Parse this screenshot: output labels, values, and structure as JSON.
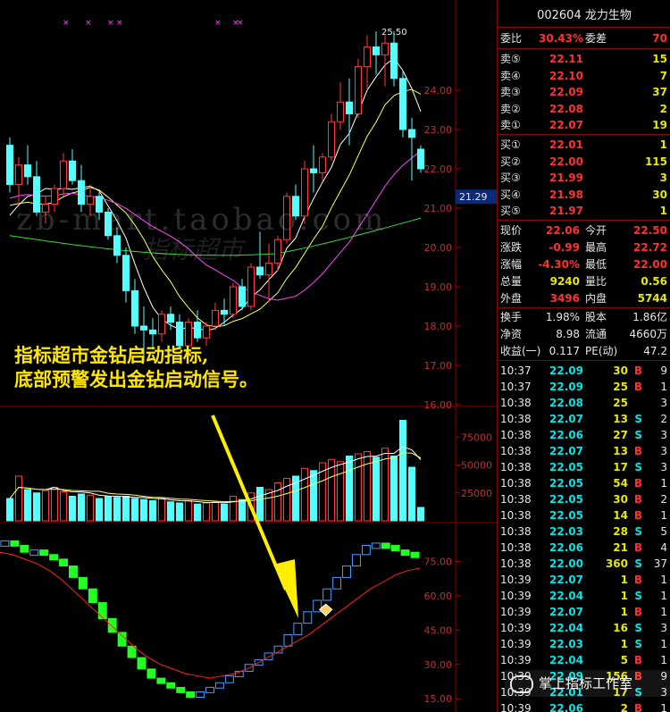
{
  "stock": {
    "code": "002604",
    "name": "龙力生物"
  },
  "price_axis": {
    "ticks": [
      {
        "label": "24.00",
        "value": 24.0
      },
      {
        "label": "23.00",
        "value": 23.0
      },
      {
        "label": "22.00",
        "value": 22.0
      },
      {
        "label": "21.00",
        "value": 21.0
      },
      {
        "label": "20.00",
        "value": 20.0
      },
      {
        "label": "19.00",
        "value": 19.0
      },
      {
        "label": "18.00",
        "value": 18.0
      },
      {
        "label": "17.00",
        "value": 17.0
      },
      {
        "label": "16.00",
        "value": 16.0
      }
    ],
    "current_label": "21.29",
    "high_label": "25.50"
  },
  "volume_axis": {
    "ticks": [
      {
        "label": "75000",
        "value": 75000
      },
      {
        "label": "50000",
        "value": 50000
      },
      {
        "label": "25000",
        "value": 25000
      }
    ]
  },
  "indicator_axis": {
    "ticks": [
      {
        "label": "75.00",
        "value": 75
      },
      {
        "label": "60.00",
        "value": 60
      },
      {
        "label": "45.00",
        "value": 45
      },
      {
        "label": "30.00",
        "value": 30
      },
      {
        "label": "15.00",
        "value": 15
      }
    ]
  },
  "chart_data": {
    "type": "candlestick",
    "title": "",
    "colors": {
      "up": "#ff3b3b",
      "down": "#54ffff",
      "ma5": "#ffffff",
      "ma10": "#ffff66",
      "ma20": "#ff44ff",
      "ma60": "#33dd33",
      "vol_up": "#ff3b3b",
      "vol_down": "#54ffff",
      "ind_up": "#4a9dff",
      "ind_down": "#22ff22",
      "signal": "#ff2020"
    },
    "ohlc": [
      [
        22.6,
        22.8,
        21.4,
        21.6
      ],
      [
        21.6,
        22.3,
        21.1,
        22.1
      ],
      [
        22.1,
        22.6,
        21.6,
        21.8
      ],
      [
        21.8,
        22.2,
        20.8,
        20.9
      ],
      [
        20.9,
        21.3,
        20.6,
        21.1
      ],
      [
        21.1,
        21.6,
        20.9,
        21.5
      ],
      [
        21.5,
        22.4,
        21.3,
        22.2
      ],
      [
        22.2,
        22.5,
        21.6,
        21.7
      ],
      [
        21.7,
        22.1,
        20.9,
        21.1
      ],
      [
        21.1,
        21.6,
        20.8,
        21.3
      ],
      [
        21.3,
        21.4,
        20.7,
        20.9
      ],
      [
        20.9,
        21.0,
        20.2,
        20.3
      ],
      [
        20.3,
        20.5,
        19.6,
        19.8
      ],
      [
        19.8,
        20.0,
        18.6,
        18.9
      ],
      [
        18.9,
        19.2,
        17.8,
        18.0
      ],
      [
        18.0,
        18.5,
        17.1,
        17.9
      ],
      [
        17.9,
        18.2,
        17.4,
        17.8
      ],
      [
        17.8,
        18.4,
        17.6,
        18.3
      ],
      [
        18.3,
        18.5,
        17.9,
        18.1
      ],
      [
        18.1,
        18.3,
        17.4,
        17.5
      ],
      [
        17.5,
        18.2,
        17.3,
        18.1
      ],
      [
        18.1,
        18.4,
        17.6,
        17.7
      ],
      [
        17.7,
        18.1,
        17.5,
        18.0
      ],
      [
        18.0,
        18.6,
        17.9,
        18.4
      ],
      [
        18.4,
        18.7,
        18.0,
        18.3
      ],
      [
        18.3,
        19.1,
        18.2,
        19.0
      ],
      [
        19.0,
        19.2,
        18.4,
        18.5
      ],
      [
        18.5,
        19.6,
        18.4,
        19.5
      ],
      [
        19.5,
        20.4,
        19.2,
        19.3
      ],
      [
        19.3,
        20.1,
        18.6,
        19.6
      ],
      [
        19.6,
        20.3,
        19.4,
        20.2
      ],
      [
        20.2,
        21.4,
        20.1,
        21.3
      ],
      [
        21.3,
        21.6,
        20.7,
        20.8
      ],
      [
        20.8,
        22.2,
        20.6,
        22.0
      ],
      [
        22.0,
        22.6,
        21.4,
        21.9
      ],
      [
        21.9,
        22.4,
        21.7,
        22.3
      ],
      [
        22.3,
        23.4,
        22.2,
        23.2
      ],
      [
        23.2,
        24.2,
        23.0,
        23.7
      ],
      [
        23.7,
        24.3,
        22.6,
        23.4
      ],
      [
        23.4,
        24.8,
        23.3,
        24.6
      ],
      [
        24.6,
        25.4,
        24.0,
        25.1
      ],
      [
        25.1,
        25.5,
        24.4,
        24.9
      ],
      [
        24.9,
        25.4,
        24.1,
        25.2
      ],
      [
        25.2,
        25.5,
        24.1,
        24.3
      ],
      [
        24.3,
        24.5,
        22.8,
        23.0
      ],
      [
        23.0,
        23.3,
        21.7,
        22.8
      ],
      [
        22.5,
        22.6,
        21.9,
        22.0
      ]
    ],
    "volume": [
      20000,
      40000,
      28000,
      25000,
      27000,
      30000,
      26000,
      22000,
      24000,
      23000,
      20000,
      22000,
      21000,
      22000,
      20000,
      19000,
      18000,
      20000,
      17000,
      16000,
      18000,
      15000,
      16000,
      17000,
      15000,
      22000,
      19000,
      25000,
      30000,
      28000,
      34000,
      38000,
      40000,
      47000,
      45000,
      52000,
      55000,
      53000,
      58000,
      60000,
      62000,
      57000,
      65000,
      58000,
      90000,
      48000,
      12000
    ],
    "indicator": [
      84,
      82,
      79,
      80,
      78,
      76,
      73,
      68,
      63,
      57,
      50,
      44,
      38,
      33,
      28,
      24,
      22,
      20,
      18,
      17,
      18,
      20,
      22,
      25,
      27,
      30,
      32,
      35,
      38,
      43,
      48,
      53,
      58,
      63,
      68,
      73,
      78,
      82,
      83,
      82,
      80,
      79,
      77
    ],
    "indicator_signal": [
      79,
      78,
      76,
      74,
      71,
      67,
      62,
      57,
      52,
      47,
      42,
      37,
      33,
      30,
      28,
      26,
      25,
      24,
      25,
      26,
      28,
      31,
      34,
      37,
      40,
      43,
      47,
      51,
      55,
      59,
      63,
      66,
      69,
      71,
      72
    ],
    "signal_index": 33,
    "ylim_price": [
      16.0,
      26.0
    ],
    "ylim_volume": [
      0,
      100000
    ],
    "ylim_indicator": [
      10,
      90
    ]
  },
  "annotation": {
    "line1": "指标超市金钻启动指标,",
    "line2": "底部预警发出金钻启动信号。"
  },
  "watermark": {
    "text": "zb-mart.taobao.com",
    "sub": "指标超市"
  },
  "quote": {
    "weibi_label": "委比",
    "weibi": "30.43%",
    "weicha_label": "委差",
    "weicha": "70",
    "asks": [
      {
        "label": "卖⑤",
        "price": "22.11",
        "vol": "15"
      },
      {
        "label": "卖④",
        "price": "22.10",
        "vol": "7"
      },
      {
        "label": "卖③",
        "price": "22.09",
        "vol": "37"
      },
      {
        "label": "卖②",
        "price": "22.08",
        "vol": "2"
      },
      {
        "label": "卖①",
        "price": "22.07",
        "vol": "19"
      }
    ],
    "bids": [
      {
        "label": "买①",
        "price": "22.01",
        "vol": "1"
      },
      {
        "label": "买②",
        "price": "22.00",
        "vol": "115"
      },
      {
        "label": "买③",
        "price": "21.99",
        "vol": "3"
      },
      {
        "label": "买④",
        "price": "21.98",
        "vol": "30"
      },
      {
        "label": "买⑤",
        "price": "21.97",
        "vol": "1"
      }
    ],
    "stats": [
      {
        "l1": "现价",
        "v1": "22.06",
        "c1": "red",
        "l2": "今开",
        "v2": "22.50",
        "c2": "red"
      },
      {
        "l1": "涨跌",
        "v1": "-0.99",
        "c1": "red",
        "l2": "最高",
        "v2": "22.72",
        "c2": "red"
      },
      {
        "l1": "涨幅",
        "v1": "-4.30%",
        "c1": "red",
        "l2": "最低",
        "v2": "22.00",
        "c2": "red"
      },
      {
        "l1": "总量",
        "v1": "9240",
        "c1": "yel",
        "l2": "量比",
        "v2": "0.56",
        "c2": "yel"
      },
      {
        "l1": "外盘",
        "v1": "3496",
        "c1": "red",
        "l2": "内盘",
        "v2": "5744",
        "c2": "yel"
      }
    ],
    "extra": [
      {
        "l1": "换手",
        "v1": "1.98%",
        "l2": "股本",
        "v2": "1.86亿"
      },
      {
        "l1": "净资",
        "v1": "8.98",
        "l2": "流通",
        "v2": "4660万"
      },
      {
        "l1": "收益(一)",
        "v1": "0.117",
        "l2": "PE(动)",
        "v2": "47.2"
      }
    ],
    "ticks": [
      {
        "t": "10:37",
        "p": "22.09",
        "v": "30",
        "s": "B",
        "n": "9"
      },
      {
        "t": "10:37",
        "p": "22.09",
        "v": "25",
        "s": "B",
        "n": "1"
      },
      {
        "t": "10:38",
        "p": "22.08",
        "v": "25",
        "s": "",
        "n": "3"
      },
      {
        "t": "10:38",
        "p": "22.07",
        "v": "13",
        "s": "S",
        "n": "2"
      },
      {
        "t": "10:38",
        "p": "22.06",
        "v": "27",
        "s": "S",
        "n": "3"
      },
      {
        "t": "10:38",
        "p": "22.07",
        "v": "13",
        "s": "B",
        "n": "3"
      },
      {
        "t": "10:38",
        "p": "22.05",
        "v": "17",
        "s": "S",
        "n": "3"
      },
      {
        "t": "10:38",
        "p": "22.05",
        "v": "54",
        "s": "B",
        "n": "1"
      },
      {
        "t": "10:38",
        "p": "22.05",
        "v": "30",
        "s": "B",
        "n": "2"
      },
      {
        "t": "10:38",
        "p": "22.05",
        "v": "14",
        "s": "B",
        "n": "1"
      },
      {
        "t": "10:38",
        "p": "22.03",
        "v": "28",
        "s": "S",
        "n": "5"
      },
      {
        "t": "10:38",
        "p": "22.06",
        "v": "21",
        "s": "B",
        "n": "4"
      },
      {
        "t": "10:38",
        "p": "22.00",
        "v": "360",
        "s": "S",
        "n": "37"
      },
      {
        "t": "10:39",
        "p": "22.07",
        "v": "1",
        "s": "B",
        "n": "1"
      },
      {
        "t": "10:39",
        "p": "22.04",
        "v": "1",
        "s": "S",
        "n": "1"
      },
      {
        "t": "10:39",
        "p": "22.07",
        "v": "1",
        "s": "B",
        "n": "1"
      },
      {
        "t": "10:39",
        "p": "22.04",
        "v": "16",
        "s": "S",
        "n": "3"
      },
      {
        "t": "10:39",
        "p": "22.03",
        "v": "1",
        "s": "S",
        "n": "1"
      },
      {
        "t": "10:39",
        "p": "22.04",
        "v": "5",
        "s": "B",
        "n": "1"
      },
      {
        "t": "10:39",
        "p": "22.09",
        "v": "156",
        "s": "B",
        "n": "9"
      },
      {
        "t": "10:39",
        "p": "22.01",
        "v": "17",
        "s": "S",
        "n": "3"
      },
      {
        "t": "10:39",
        "p": "22.06",
        "v": "2",
        "s": "B",
        "n": "1"
      }
    ]
  },
  "logo": {
    "text": "掌上指标工作室"
  }
}
